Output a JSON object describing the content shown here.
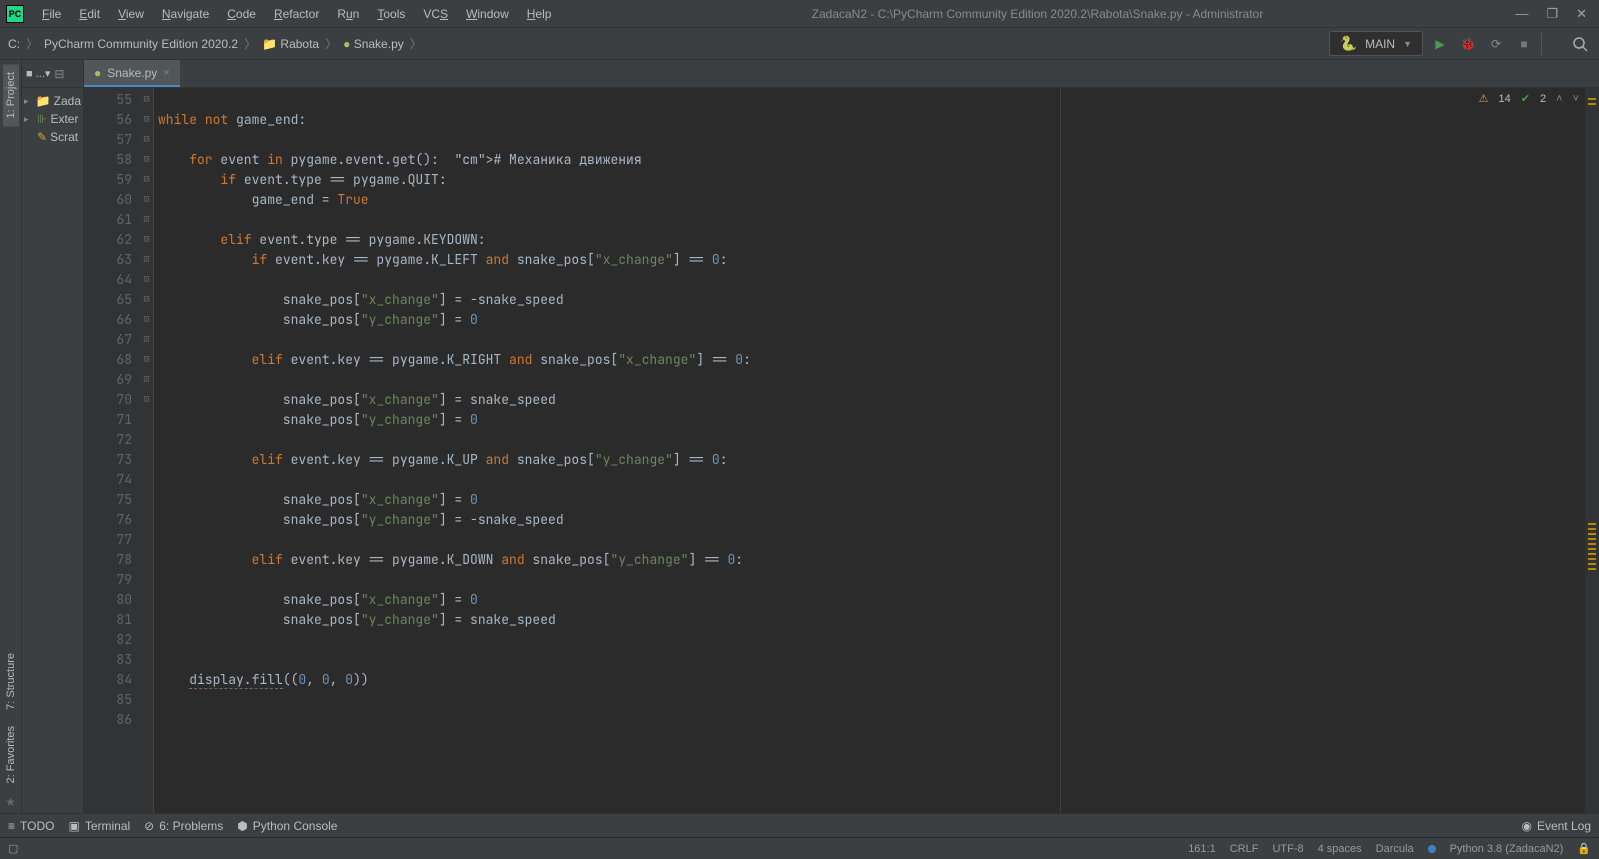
{
  "titlebar": {
    "logo_text": "PC",
    "menu": [
      "File",
      "Edit",
      "View",
      "Navigate",
      "Code",
      "Refactor",
      "Run",
      "Tools",
      "VCS",
      "Window",
      "Help"
    ],
    "menu_ul": [
      "F",
      "E",
      "V",
      "N",
      "C",
      "R",
      "u",
      "T",
      "S",
      "W",
      "H"
    ],
    "title": "ZadacaN2 - C:\\PyCharm Community Edition 2020.2\\Rabota\\Snake.py - Administrator"
  },
  "navbar": {
    "crumbs": [
      "C:",
      "PyCharm Community Edition 2020.2",
      "Rabota",
      "Snake.py"
    ],
    "run_config": "MAIN"
  },
  "project": {
    "items": [
      {
        "icon": "folder",
        "label": "Zada"
      },
      {
        "icon": "lib",
        "label": "Exter"
      },
      {
        "icon": "scratch",
        "label": "Scrat"
      }
    ]
  },
  "left_tabs": {
    "project": "1: Project",
    "structure": "7: Structure",
    "favorites": "2: Favorites"
  },
  "tab": {
    "name": "Snake.py"
  },
  "gutter": {
    "start": 55,
    "end": 86
  },
  "inspection": {
    "warnings": "14",
    "passes": "2"
  },
  "code_lines": [
    {
      "n": 55,
      "t": ""
    },
    {
      "n": 56,
      "t": "while not game_end:"
    },
    {
      "n": 57,
      "t": ""
    },
    {
      "n": 58,
      "t": "    for event in pygame.event.get():  # Механика движения"
    },
    {
      "n": 59,
      "t": "        if event.type == pygame.QUIT:"
    },
    {
      "n": 60,
      "t": "            game_end = True"
    },
    {
      "n": 61,
      "t": ""
    },
    {
      "n": 62,
      "t": "        elif event.type == pygame.KEYDOWN:"
    },
    {
      "n": 63,
      "t": "            if event.key == pygame.K_LEFT and snake_pos[\"x_change\"] == 0:"
    },
    {
      "n": 64,
      "t": ""
    },
    {
      "n": 65,
      "t": "                snake_pos[\"x_change\"] = -snake_speed"
    },
    {
      "n": 66,
      "t": "                snake_pos[\"y_change\"] = 0"
    },
    {
      "n": 67,
      "t": ""
    },
    {
      "n": 68,
      "t": "            elif event.key == pygame.K_RIGHT and snake_pos[\"x_change\"] == 0:"
    },
    {
      "n": 69,
      "t": ""
    },
    {
      "n": 70,
      "t": "                snake_pos[\"x_change\"] = snake_speed"
    },
    {
      "n": 71,
      "t": "                snake_pos[\"y_change\"] = 0"
    },
    {
      "n": 72,
      "t": ""
    },
    {
      "n": 73,
      "t": "            elif event.key == pygame.K_UP and snake_pos[\"y_change\"] == 0:"
    },
    {
      "n": 74,
      "t": ""
    },
    {
      "n": 75,
      "t": "                snake_pos[\"x_change\"] = 0"
    },
    {
      "n": 76,
      "t": "                snake_pos[\"y_change\"] = -snake_speed"
    },
    {
      "n": 77,
      "t": ""
    },
    {
      "n": 78,
      "t": "            elif event.key == pygame.K_DOWN and snake_pos[\"y_change\"] == 0:"
    },
    {
      "n": 79,
      "t": ""
    },
    {
      "n": 80,
      "t": "                snake_pos[\"x_change\"] = 0"
    },
    {
      "n": 81,
      "t": "                snake_pos[\"y_change\"] = snake_speed"
    },
    {
      "n": 82,
      "t": ""
    },
    {
      "n": 83,
      "t": ""
    },
    {
      "n": 84,
      "t": "    display.fill((0, 0, 0))"
    },
    {
      "n": 85,
      "t": ""
    },
    {
      "n": 86,
      "t": ""
    }
  ],
  "bottom_tools": {
    "todo": "TODO",
    "terminal": "Terminal",
    "problems": "6: Problems",
    "pyconsole": "Python Console",
    "event_log": "Event Log"
  },
  "statusbar": {
    "pos": "161:1",
    "eol": "CRLF",
    "enc": "UTF-8",
    "indent": "4 spaces",
    "theme": "Darcula",
    "interp": "Python 3.8 (ZadacaN2)"
  }
}
